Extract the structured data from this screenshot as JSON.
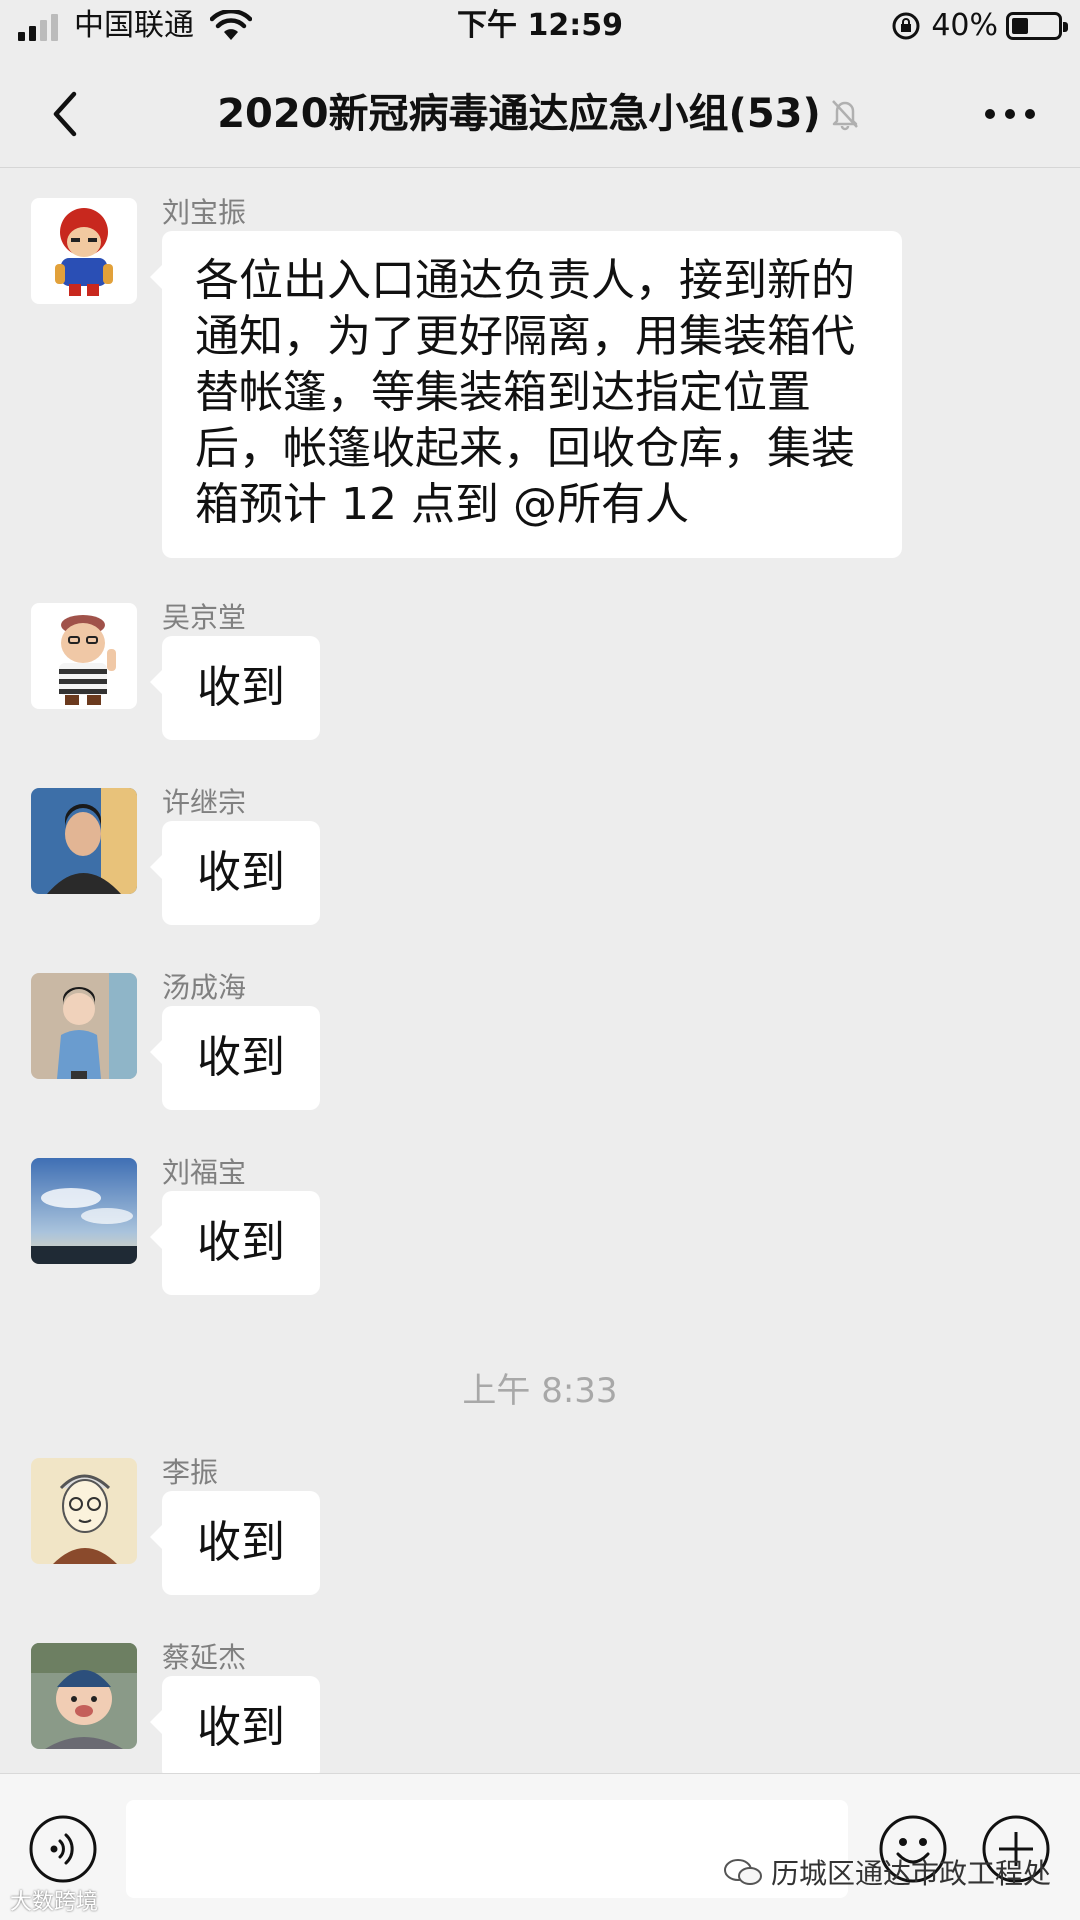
{
  "status_bar": {
    "carrier": "中国联通",
    "time": "下午 12:59",
    "battery": "40%",
    "battery_level": 0.4
  },
  "header": {
    "title": "2020新冠病毒通达应急小组(53)",
    "back_icon": "chevron-left-icon",
    "mute_icon": "bell-off-icon",
    "more_icon": "more-dots-icon"
  },
  "messages": [
    {
      "sender": "刘宝振",
      "text": "各位出入口通达负责人，接到新的通知，为了更好隔离，用集装箱代替帐篷，等集装箱到达指定位置后，帐篷收起来，回收仓库，集装箱预计 12 点到 @所有人",
      "avatar": "cartoon-avatar"
    },
    {
      "sender": "吴京堂",
      "text": "收到",
      "avatar": "cartoon-avatar"
    },
    {
      "sender": "许继宗",
      "text": "收到",
      "avatar": "photo-avatar"
    },
    {
      "sender": "汤成海",
      "text": "收到",
      "avatar": "child-photo-avatar"
    },
    {
      "sender": "刘福宝",
      "text": "收到",
      "avatar": "sky-photo-avatar"
    },
    {
      "sender": "李振",
      "text": "收到",
      "avatar": "sketch-avatar"
    },
    {
      "sender": "蔡延杰",
      "text": "收到",
      "avatar": "baby-photo-avatar"
    }
  ],
  "timestamp": "上午 8:33",
  "input_bar": {
    "voice_icon": "voice-icon",
    "emoji_icon": "emoji-icon",
    "plus_icon": "plus-icon"
  },
  "watermarks": {
    "account": "历城区通达市政工程处",
    "corner": "大数跨境"
  },
  "colors": {
    "background": "#ededed",
    "bubble": "#ffffff",
    "sender_name": "#808080"
  }
}
